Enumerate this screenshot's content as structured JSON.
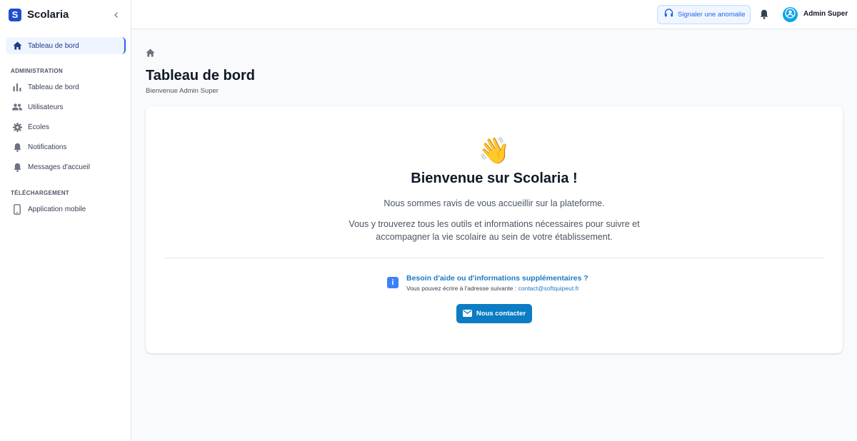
{
  "app": {
    "logo_letter": "S",
    "name": "Scolaria"
  },
  "sidebar": {
    "active_item": {
      "label": "Tableau de bord",
      "icon": "home-icon"
    },
    "sections": [
      {
        "title": "ADMINISTRATION",
        "items": [
          {
            "label": "Tableau de bord",
            "icon": "bar-chart-icon"
          },
          {
            "label": "Utilisateurs",
            "icon": "users-icon"
          },
          {
            "label": "Écoles",
            "icon": "gear-icon"
          },
          {
            "label": "Notifications",
            "icon": "bell-icon"
          },
          {
            "label": "Messages d'accueil",
            "icon": "bell-icon"
          }
        ]
      },
      {
        "title": "TÉLÉCHARGEMENT",
        "items": [
          {
            "label": "Application mobile",
            "icon": "phone-icon"
          }
        ]
      }
    ]
  },
  "topbar": {
    "report_label": "Signaler une anomalie",
    "user_name": "Admin Super"
  },
  "main": {
    "title": "Tableau de bord",
    "subtitle": "Bienvenue Admin Super",
    "card": {
      "emoji": "👋",
      "title": "Bienvenue sur Scolaria !",
      "paragraph1": "Nous sommes ravis de vous accueillir sur la plateforme.",
      "paragraph2": "Vous y trouverez tous les outils et informations nécessaires pour suivre et accompagner la vie scolaire au sein de votre établissement.",
      "help_title": "Besoin d'aide ou d'informations supplémentaires ?",
      "help_text": "Vous pouvez écrire à l'adresse suivante : ",
      "help_email": "contact@softquipeut.fr",
      "contact_label": "Nous contacter"
    }
  },
  "colors": {
    "brand": "#1f4fcf",
    "accent": "#2563eb",
    "button": "#0b7dc4",
    "link": "#1e7ac2"
  }
}
